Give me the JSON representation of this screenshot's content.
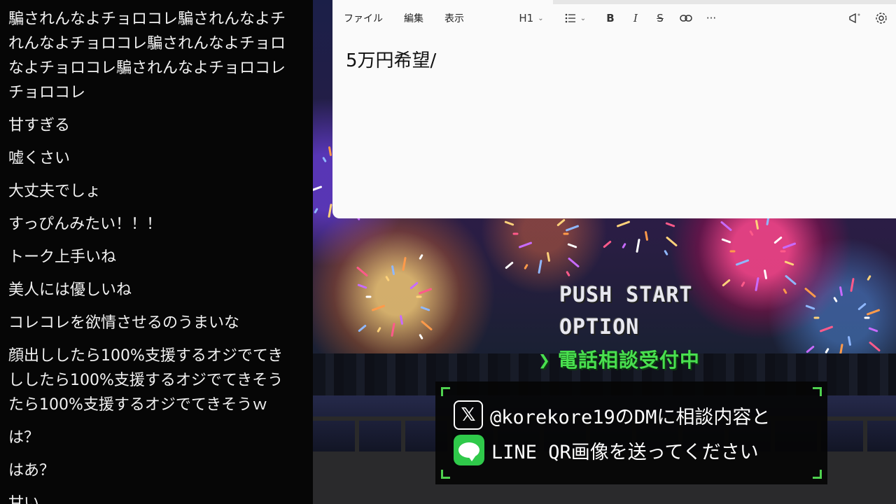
{
  "chat": {
    "messages": [
      {
        "lines": [
          "騙されんなよチョロコレ騙されんなよチ",
          "れんなよチョロコレ騙されんなよチョロ",
          "なよチョロコレ騙されんなよチョロコレ",
          "チョロコレ"
        ]
      },
      {
        "lines": [
          "甘すぎる"
        ]
      },
      {
        "lines": [
          "嘘くさい"
        ]
      },
      {
        "lines": [
          "大丈夫でしょ"
        ]
      },
      {
        "lines": [
          "すっぴんみたい！！！"
        ]
      },
      {
        "lines": [
          "トーク上手いね"
        ]
      },
      {
        "lines": [
          "美人には優しいね"
        ]
      },
      {
        "lines": [
          "コレコレを欲情させるのうまいな"
        ]
      },
      {
        "lines": [
          "顔出ししたら100%支援するオジでてき",
          "ししたら100%支援するオジでてきそう",
          "たら100%支援するオジでてきそうｗ"
        ]
      },
      {
        "lines": [
          "は？"
        ]
      },
      {
        "lines": [
          "はあ？"
        ]
      },
      {
        "lines": [
          "甘い"
        ]
      }
    ]
  },
  "editor": {
    "menu": [
      "ファイル",
      "編集",
      "表示"
    ],
    "heading_label": "H1",
    "bold_label": "B",
    "italic_label": "I",
    "strike_label": "S",
    "more_label": "···",
    "body_text": "5万円希望/"
  },
  "scene": {
    "menu_start": "PUSH START",
    "menu_option": "OPTION",
    "menu_phone": "電話相談受付中",
    "menu_arrow": "❯",
    "x_icon_glyph": "𝕏",
    "contact_x": "@korekore19のDMに相談内容と",
    "contact_line": "LINE QR画像を送ってください",
    "accent_green": "#49e04f"
  }
}
